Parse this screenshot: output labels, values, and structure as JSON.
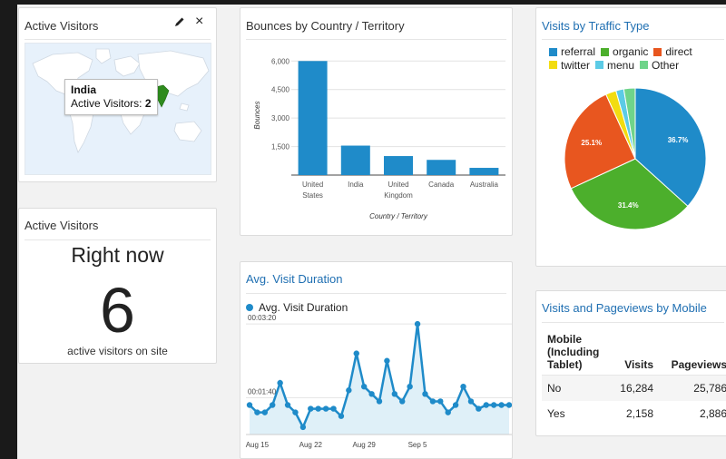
{
  "active_visitors_map": {
    "title": "Active Visitors",
    "tooltip_country": "India",
    "tooltip_label": "Active Visitors:",
    "tooltip_value": "2",
    "icons": [
      "pencil-icon",
      "close-icon"
    ],
    "close_glyph": "×"
  },
  "active_visitors_now": {
    "title": "Active Visitors",
    "label": "Right now",
    "count": "6",
    "sub": "active visitors on site"
  },
  "bounces": {
    "title": "Bounces by Country / Territory",
    "chart_data": {
      "type": "bar",
      "categories": [
        "United States",
        "India",
        "United Kingdom",
        "Canada",
        "Australia"
      ],
      "category_lines": [
        [
          "United",
          "States"
        ],
        [
          "India"
        ],
        [
          "United",
          "Kingdom"
        ],
        [
          "Canada"
        ],
        [
          "Australia"
        ]
      ],
      "values": [
        6000,
        1550,
        1000,
        800,
        380
      ],
      "yticks": [
        "1,500",
        "3,000",
        "4,500",
        "6,000"
      ],
      "ylabel": "Bounces",
      "xlabel": "Country / Territory",
      "ylim": [
        0,
        6300
      ],
      "color": "#1f8bc9"
    }
  },
  "traffic": {
    "title": "Visits by Traffic Type",
    "chart_data": {
      "type": "pie",
      "labels": [
        "referral",
        "organic",
        "direct",
        "twitter",
        "menu",
        "Other"
      ],
      "values": [
        36.7,
        31.4,
        25.1,
        2.4,
        1.8,
        2.6
      ],
      "colors": [
        "#1f8bc9",
        "#4caf2c",
        "#e8561f",
        "#f2dc10",
        "#5ccbe6",
        "#6fd48a"
      ],
      "data_labels": [
        "36.7%",
        "31.4%",
        "25.1%",
        "",
        "",
        ""
      ]
    }
  },
  "duration": {
    "title": "Avg. Visit Duration",
    "legend": "Avg. Visit Duration",
    "chart_data": {
      "type": "area",
      "series": [
        {
          "name": "Avg. Visit Duration",
          "values": [
            90,
            80,
            80,
            90,
            120,
            90,
            80,
            60,
            85,
            85,
            85,
            85,
            75,
            110,
            160,
            115,
            105,
            95,
            150,
            105,
            95,
            115,
            200,
            105,
            95,
            95,
            80,
            90,
            115,
            95,
            85,
            90,
            90,
            90,
            90
          ]
        }
      ],
      "ylim": [
        50,
        210
      ],
      "yticks": [
        "00:03:20",
        "00:01:40"
      ],
      "ytick_values": [
        200,
        100
      ],
      "xticks": [
        "Aug 15",
        "Aug 22",
        "Aug 29",
        "Sep 5"
      ],
      "xtick_index": [
        1,
        8,
        15,
        22
      ],
      "color": "#1f8bc9"
    }
  },
  "mobile": {
    "title": "Visits and Pageviews by Mobile",
    "headers": [
      "Mobile (Including Tablet)",
      "Visits",
      "Pageviews"
    ],
    "header_lines": [
      "Mobile",
      "(Including",
      "Tablet)"
    ],
    "rows": [
      {
        "label": "No",
        "visits": "16,284",
        "pageviews": "25,786"
      },
      {
        "label": "Yes",
        "visits": "2,158",
        "pageviews": "2,886"
      }
    ]
  }
}
